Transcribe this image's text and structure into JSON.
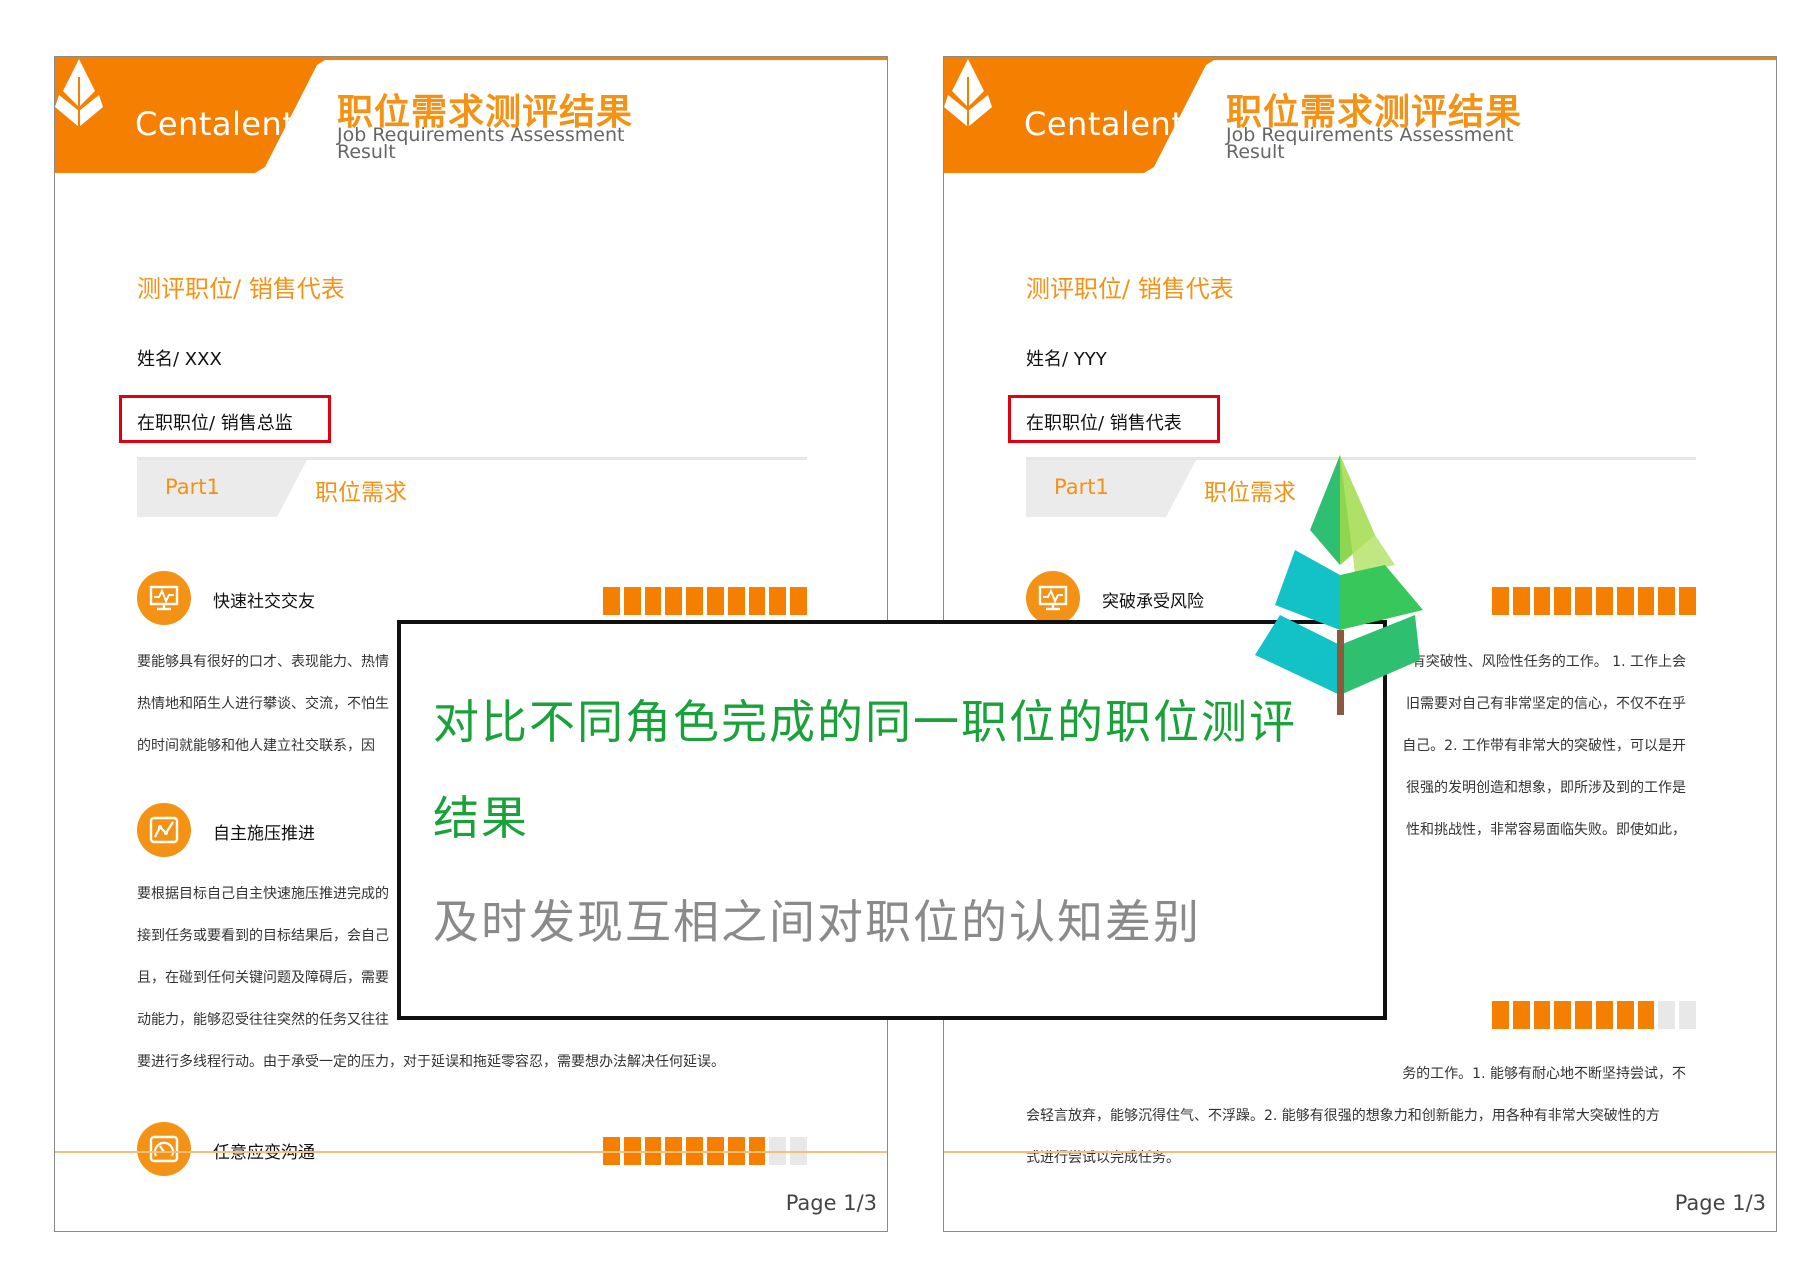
{
  "brand": "Centalent",
  "report_title_cn": "职位需求测评结果",
  "report_title_en": "Job Requirements Assessment Result",
  "part_label": "Part1",
  "part_title": "职位需求",
  "page_label": "Page 1/3",
  "accent_color": "#f39214",
  "left_doc": {
    "position": "测评职位/ 销售代表",
    "name": "姓名/ XXX",
    "current_position": "在职职位/ 销售总监",
    "items": [
      {
        "title": "快速社交交友",
        "icon": "monitor-chart-icon",
        "score": 10,
        "max": 10,
        "lines": [
          "要能够具有很好的口才、表现能力、热情",
          "热情地和陌生人进行攀谈、交流，不怕生",
          "的时间就能够和他人建立社交联系，因"
        ]
      },
      {
        "title": "自主施压推进",
        "icon": "line-chart-icon",
        "score": null,
        "max": 10,
        "lines": [
          "要根据目标自己自主快速施压推进完成的",
          "接到任务或要看到的目标结果后，会自己",
          "且，在碰到任何关键问题及障碍后，需要",
          "动能力，能够忍受往往突然的任务又往往",
          "要进行多线程行动。由于承受一定的压力，对于延误和拖延零容忍，需要想办法解决任何延误。"
        ]
      },
      {
        "title": "任意应变沟通",
        "icon": "gauge-icon",
        "score": 8,
        "max": 10,
        "lines": []
      }
    ]
  },
  "right_doc": {
    "position": "测评职位/ 销售代表",
    "name": "姓名/ YYY",
    "current_position": "在职职位/ 销售代表",
    "items": [
      {
        "title": "突破承受风险",
        "icon": "monitor-chart-icon",
        "score": 10,
        "max": 10,
        "lines": [
          "有突破性、风险性任务的工作。 1. 工作上会",
          "旧需要对自己有非常坚定的信心，不仅不在乎",
          "自己。2. 工作带有非常大的突破性，可以是开",
          "很强的发明创造和想象，即所涉及到的工作是",
          "性和挑战性，非常容易面临失败。即使如此，"
        ]
      },
      {
        "title": "",
        "icon": "",
        "score": 8,
        "max": 10,
        "lines": [
          "务的工作。1. 能够有耐心地不断坚持尝试，不",
          "会轻言放弃，能够沉得住气、不浮躁。2. 能够有很强的想象力和创新能力，用各种有非常大突破性的方",
          "式进行尝试以完成任务。"
        ]
      }
    ]
  },
  "overlay": {
    "headline": "对比不同角色完成的同一职位的职位测评结果",
    "subline": "及时发现互相之间对职位的认知差别"
  }
}
